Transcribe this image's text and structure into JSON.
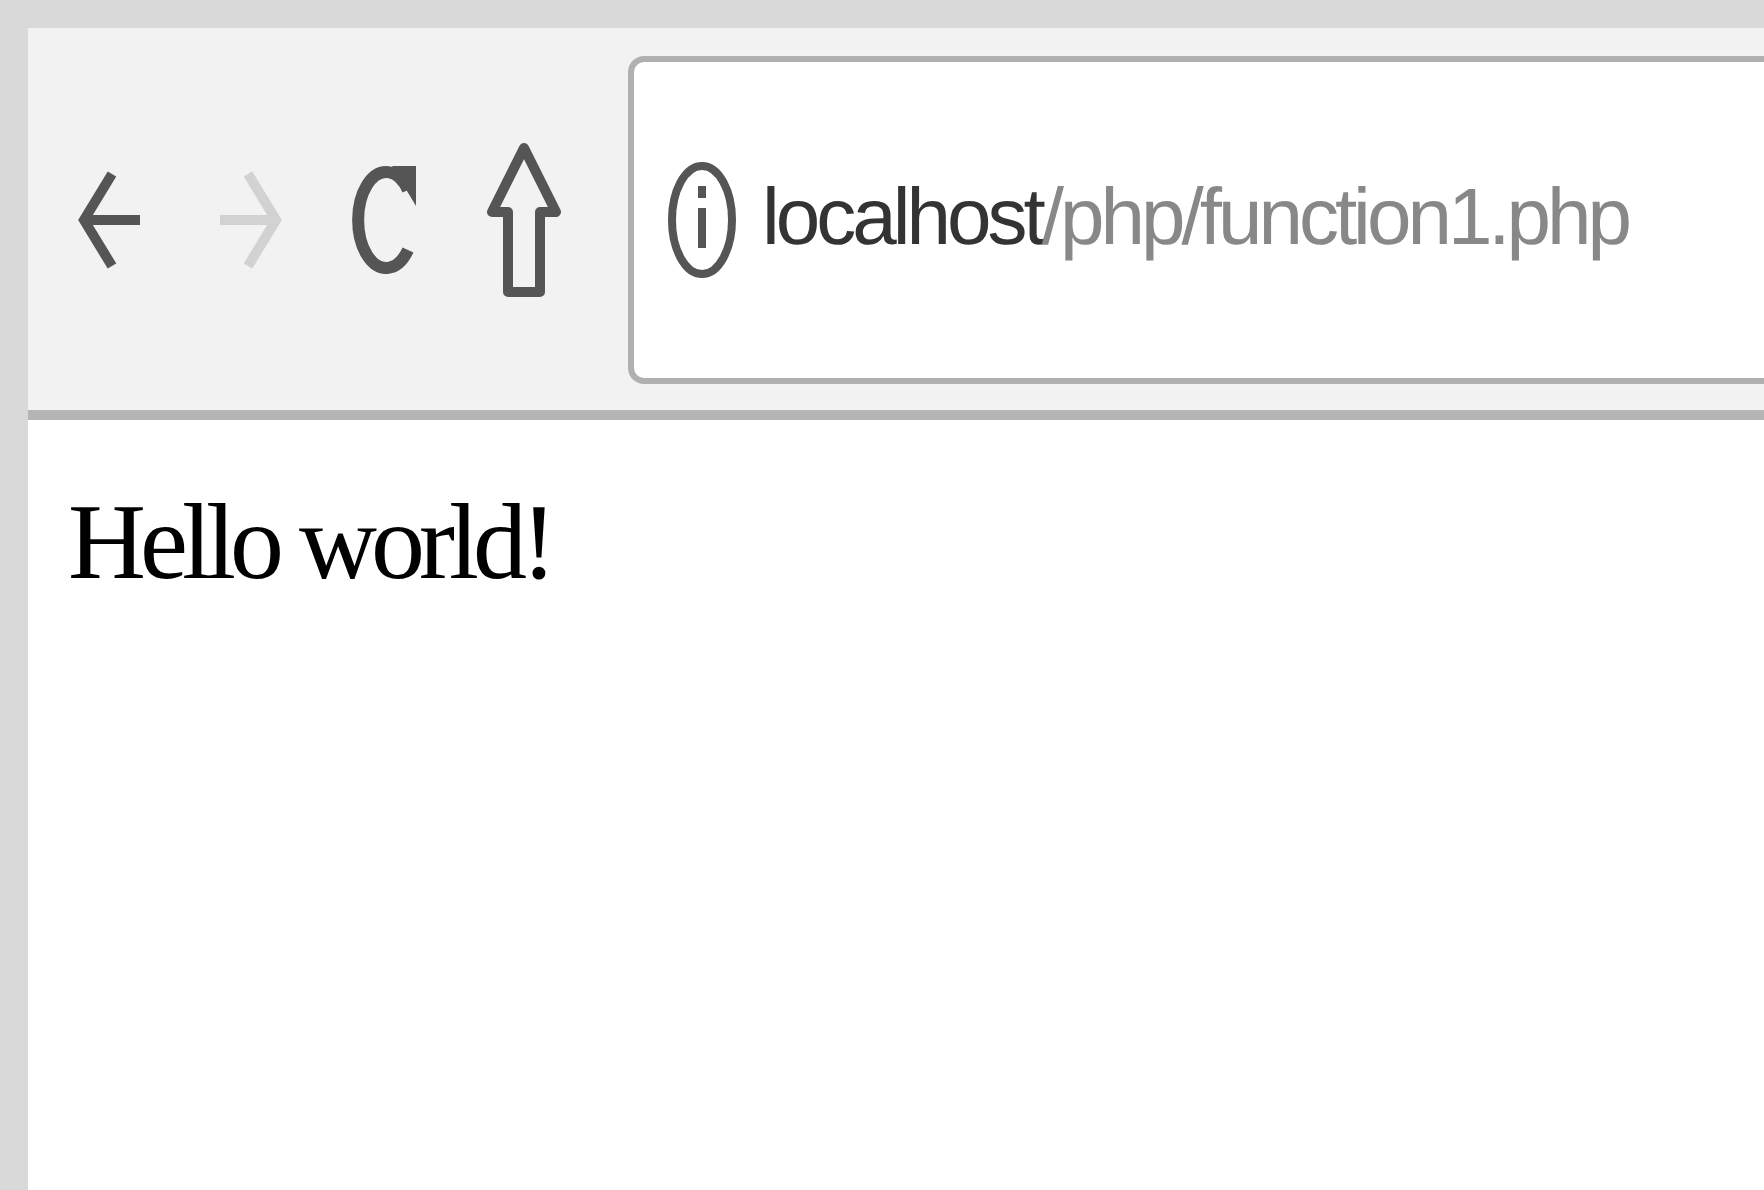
{
  "toolbar": {
    "buttons": [
      {
        "kind": "back",
        "disabled": false
      },
      {
        "kind": "forward",
        "disabled": true
      },
      {
        "kind": "reload",
        "disabled": false
      },
      {
        "kind": "home",
        "disabled": false
      }
    ]
  },
  "address_bar": {
    "host": "localhost",
    "path": "/php/function1.php"
  },
  "page": {
    "text": "Hello world!"
  }
}
